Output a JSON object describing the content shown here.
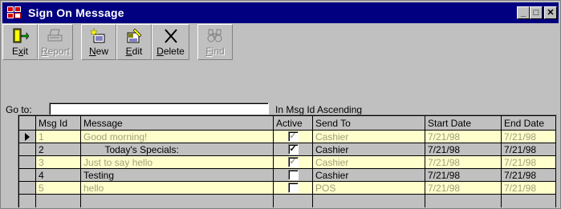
{
  "window": {
    "title": "Sign On Message",
    "minimize": "_",
    "maximize": "□",
    "close": "✕"
  },
  "toolbar": {
    "buttons": [
      {
        "label": "Exit",
        "icon": "exit-door-icon",
        "enabled": true
      },
      {
        "label": "Report",
        "icon": "printer-icon",
        "enabled": false
      },
      {
        "label": "New",
        "icon": "new-record-icon",
        "enabled": true
      },
      {
        "label": "Edit",
        "icon": "edit-record-icon",
        "enabled": true
      },
      {
        "label": "Delete",
        "icon": "delete-x-icon",
        "enabled": true
      },
      {
        "label": "Find",
        "icon": "binoculars-icon",
        "enabled": false
      }
    ]
  },
  "goto": {
    "label": "Go to:",
    "value": "",
    "sort_text": "In Msg Id Ascending"
  },
  "grid": {
    "columns": [
      "Msg Id",
      "Message",
      "Active",
      "Send To",
      "Start Date",
      "End Date"
    ],
    "rows": [
      {
        "msg_id": "1",
        "message": "Good morning!",
        "active": true,
        "send_to": "Cashier",
        "start": "7/21/98",
        "end": "7/21/98",
        "highlight": true,
        "current": true
      },
      {
        "msg_id": "2",
        "message": "        Today's Specials:",
        "active": true,
        "send_to": "Cashier",
        "start": "7/21/98",
        "end": "7/21/98",
        "highlight": false,
        "current": false
      },
      {
        "msg_id": "3",
        "message": "Just to say hello",
        "active": true,
        "send_to": "Cashier",
        "start": "7/21/98",
        "end": "7/21/98",
        "highlight": true,
        "current": false
      },
      {
        "msg_id": "4",
        "message": "Testing",
        "active": false,
        "send_to": "Cashier",
        "start": "7/21/98",
        "end": "7/21/98",
        "highlight": false,
        "current": false
      },
      {
        "msg_id": "5",
        "message": "hello",
        "active": false,
        "send_to": "POS",
        "start": "7/21/98",
        "end": "7/21/98",
        "highlight": true,
        "current": false
      }
    ]
  },
  "colors": {
    "titlebar": "#000080",
    "highlight_row": "#ffffcc",
    "highlight_text": "#a0a07a"
  }
}
